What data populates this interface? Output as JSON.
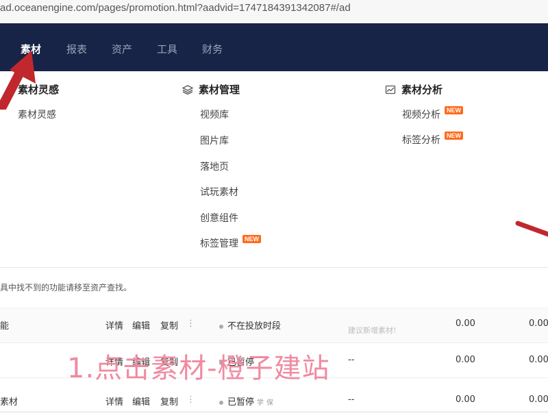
{
  "browser": {
    "url": "ad.oceanengine.com/pages/promotion.html?aadvid=1747184391342087#/ad"
  },
  "topnav": {
    "items": [
      {
        "label": "素材",
        "active": true
      },
      {
        "label": "报表",
        "active": false
      },
      {
        "label": "资产",
        "active": false
      },
      {
        "label": "工具",
        "active": false
      },
      {
        "label": "财务",
        "active": false
      }
    ]
  },
  "menu": {
    "columns": [
      {
        "title": "素材灵感",
        "items": [
          {
            "label": "素材灵感"
          }
        ]
      },
      {
        "title": "素材管理",
        "icon": "layers-icon",
        "items": [
          {
            "label": "视频库"
          },
          {
            "label": "图片库"
          },
          {
            "label": "落地页"
          },
          {
            "label": "试玩素材"
          },
          {
            "label": "创意组件"
          },
          {
            "label": "标签管理",
            "badge": "NEW"
          }
        ]
      },
      {
        "title": "素材分析",
        "icon": "image-chart-icon",
        "items": [
          {
            "label": "视频分析",
            "badge": "NEW"
          },
          {
            "label": "标签分析",
            "badge": "NEW"
          }
        ]
      }
    ]
  },
  "hint": {
    "text": "具中找不到的功能请移至资产查找。"
  },
  "table": {
    "rows": [
      {
        "name": "能",
        "actions": [
          "详情",
          "编辑",
          "复制"
        ],
        "status": "不在投放时段",
        "middle": "建议新增素材!",
        "value1": "0.00",
        "value2": "0.00"
      },
      {
        "name": "",
        "actions": [
          "详情",
          "编辑",
          "复制"
        ],
        "status": "已暂停",
        "middle": "--",
        "value1": "0.00",
        "value2": "0.00"
      },
      {
        "name": "素材",
        "actions": [
          "详情",
          "编辑",
          "复制"
        ],
        "status": "已暂停",
        "status_tags": [
          "学",
          "保"
        ],
        "middle": "--",
        "value1": "0.00",
        "value2": "0.00"
      }
    ]
  },
  "annotation": {
    "text": "1.点击素材-橙子建站"
  },
  "colors": {
    "nav_bg": "#172447",
    "badge": "#ff6a1a",
    "arrow": "#c0282d",
    "annotation": "#f08aa0"
  }
}
